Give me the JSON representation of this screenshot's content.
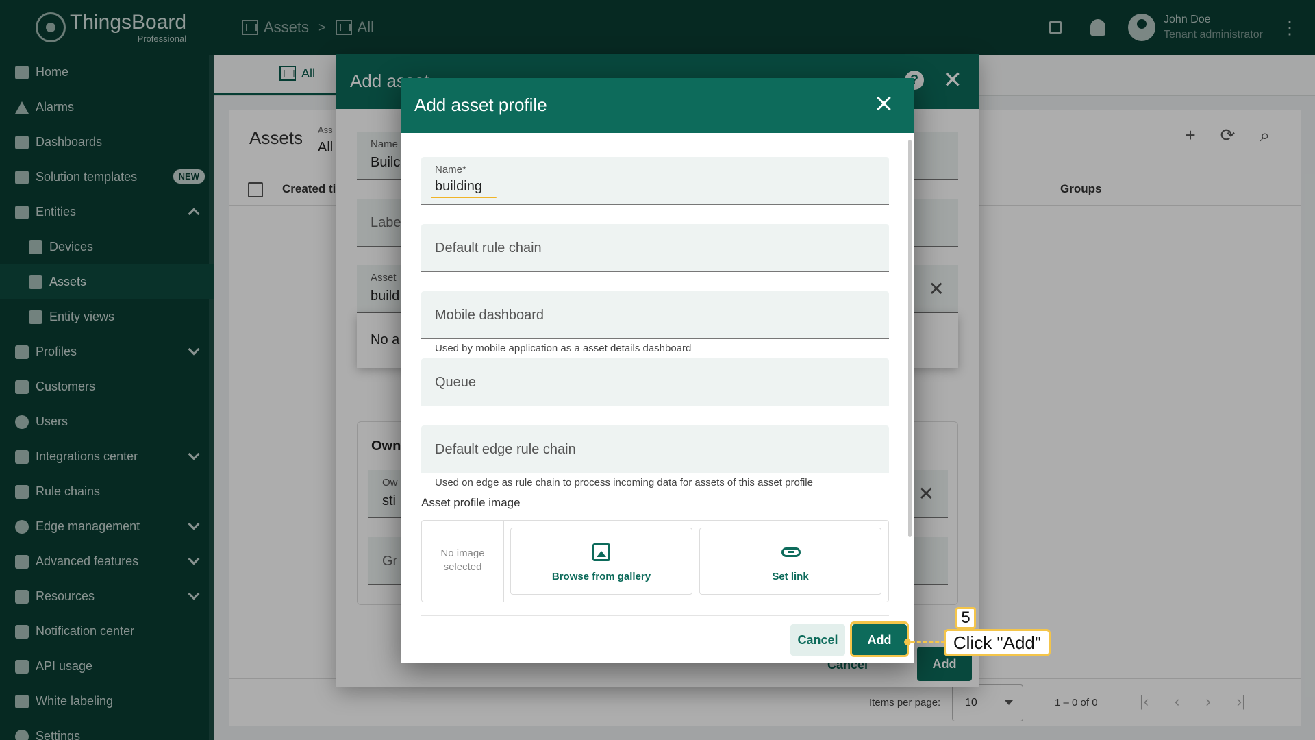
{
  "app": {
    "brand": "ThingsBoard",
    "edition": "Professional"
  },
  "breadcrumb": [
    {
      "label": "Assets"
    },
    {
      "label": "All"
    }
  ],
  "breadcrumb_separator": ">",
  "user": {
    "name": "John Doe",
    "role": "Tenant administrator"
  },
  "sidebar": {
    "items": [
      {
        "label": "Home"
      },
      {
        "label": "Alarms"
      },
      {
        "label": "Dashboards"
      },
      {
        "label": "Solution templates",
        "badge": "NEW"
      },
      {
        "label": "Entities"
      },
      {
        "label": "Devices"
      },
      {
        "label": "Assets"
      },
      {
        "label": "Entity views"
      },
      {
        "label": "Profiles"
      },
      {
        "label": "Customers"
      },
      {
        "label": "Users"
      },
      {
        "label": "Integrations center"
      },
      {
        "label": "Rule chains"
      },
      {
        "label": "Edge management"
      },
      {
        "label": "Advanced features"
      },
      {
        "label": "Resources"
      },
      {
        "label": "Notification center"
      },
      {
        "label": "API usage"
      },
      {
        "label": "White labeling"
      },
      {
        "label": "Settings"
      }
    ]
  },
  "background": {
    "tab": "All",
    "title": "Assets",
    "filter_label": "Ass",
    "filter_value": "All",
    "columns": {
      "created": "Created ti",
      "groups": "Groups"
    },
    "footer": {
      "items_per_page_label": "Items per page:",
      "items_per_page": "10",
      "range": "1 – 0 of 0"
    }
  },
  "add_asset_dialog": {
    "title": "Add asset",
    "name_label": "Name",
    "name_value": "Builc",
    "label_placeholder": "Labe",
    "profile_label": "Asset",
    "profile_value": "build",
    "popup_text": "No a",
    "owner_title": "Own",
    "owner_label": "Ow",
    "owner_value": "sti",
    "groups_placeholder": "Gr",
    "cancel": "Cancel",
    "add": "Add"
  },
  "dialog": {
    "title": "Add asset profile",
    "name_label": "Name*",
    "name_value": "building",
    "default_rule_chain": "Default rule chain",
    "mobile_dashboard": "Mobile dashboard",
    "mobile_hint": "Used by mobile application as a asset details dashboard",
    "queue": "Queue",
    "default_edge_rule_chain": "Default edge rule chain",
    "edge_hint": "Used on edge as rule chain to process incoming data for assets of this asset profile",
    "image_section": "Asset profile image",
    "no_image_line1": "No image",
    "no_image_line2": "selected",
    "browse_gallery": "Browse from gallery",
    "set_link": "Set link",
    "cancel": "Cancel",
    "add": "Add"
  },
  "annotation": {
    "step": "5",
    "label": "Click \"Add\"",
    "color": "#f4c54a"
  },
  "colors": {
    "primary": "#0d6b5b",
    "nav": "#0a3d33"
  }
}
